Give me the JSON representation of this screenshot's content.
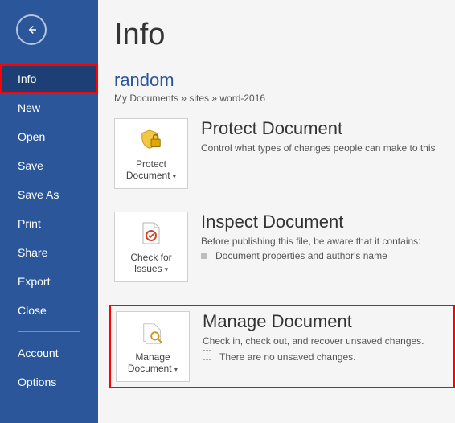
{
  "sidebar": {
    "items": [
      {
        "label": "Info",
        "selected": true
      },
      {
        "label": "New"
      },
      {
        "label": "Open"
      },
      {
        "label": "Save"
      },
      {
        "label": "Save As"
      },
      {
        "label": "Print"
      },
      {
        "label": "Share"
      },
      {
        "label": "Export"
      },
      {
        "label": "Close"
      }
    ],
    "footer": [
      {
        "label": "Account"
      },
      {
        "label": "Options"
      }
    ]
  },
  "page": {
    "title": "Info",
    "docName": "random",
    "docPath": "My Documents » sites » word-2016"
  },
  "sections": {
    "protect": {
      "tileLabel": "Protect Document",
      "heading": "Protect Document",
      "desc": "Control what types of changes people can make to this"
    },
    "inspect": {
      "tileLabel": "Check for Issues",
      "heading": "Inspect Document",
      "desc": "Before publishing this file, be aware that it contains:",
      "bullet": "Document properties and author's name"
    },
    "manage": {
      "tileLabel": "Manage Document",
      "heading": "Manage Document",
      "desc": "Check in, check out, and recover unsaved changes.",
      "bullet": "There are no unsaved changes."
    }
  }
}
